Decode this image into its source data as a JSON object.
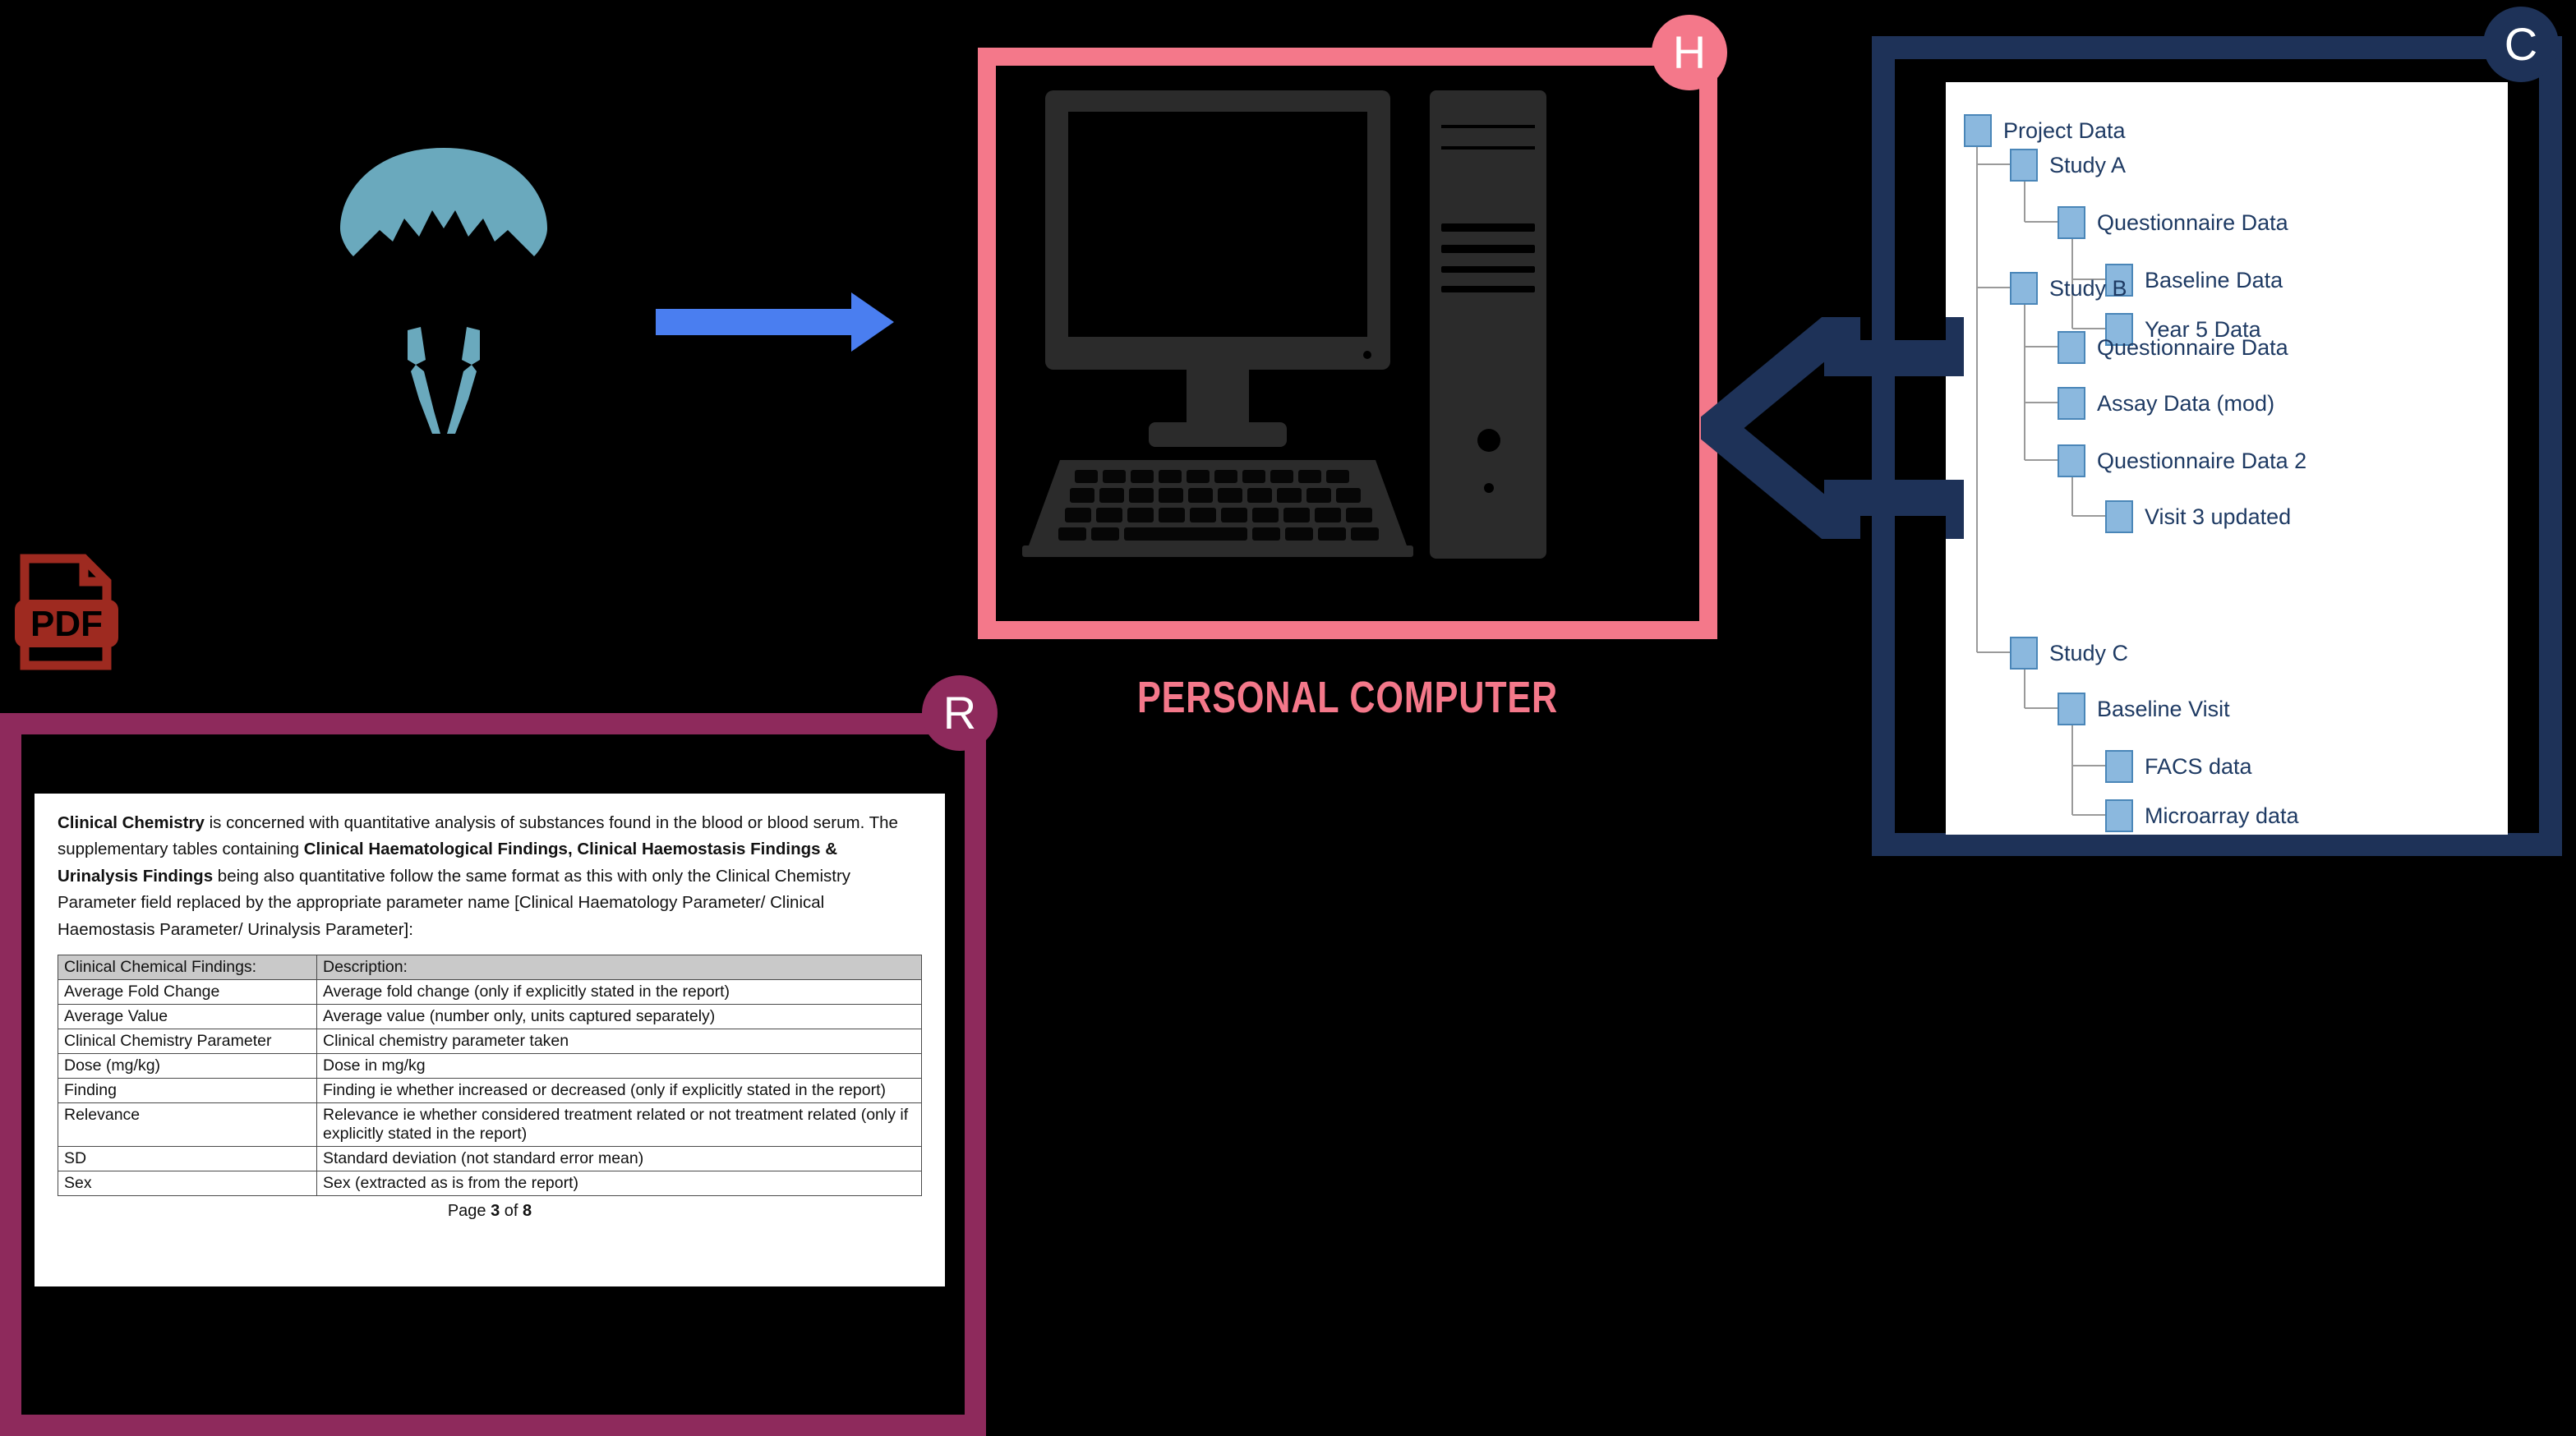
{
  "badges": {
    "h": {
      "label": "H",
      "color": "#f4788a"
    },
    "c": {
      "label": "C",
      "color": "#1e3258"
    },
    "r": {
      "label": "R",
      "color": "#8e2a5c"
    }
  },
  "computer_panel": {
    "caption": "PERSONAL COMPUTER",
    "caption_color": "#f4788a",
    "frame_color": "#f4788a",
    "icon": "desktop-computer-icon"
  },
  "source_icons": {
    "parachute": {
      "name": "parachute-icon",
      "color": "#6aa9bd"
    },
    "pdf": {
      "name": "pdf-file-icon",
      "label": "PDF",
      "color": "#9e2a20"
    },
    "blue_arrow": {
      "name": "right-arrow-icon",
      "color": "#4a7ef0"
    },
    "navy_arrow": {
      "name": "left-arrow-icon",
      "color": "#1e3258"
    }
  },
  "tree": {
    "frame_color": "#1e3258",
    "node_fill": "#8bb8de",
    "node_stroke": "#4a86b8",
    "label_color": "#1e3a63",
    "items": [
      {
        "label": "Project Data",
        "depth": 0
      },
      {
        "label": "Study A",
        "depth": 1
      },
      {
        "label": "Questionnaire Data",
        "depth": 2
      },
      {
        "label": "Baseline Data",
        "depth": 3
      },
      {
        "label": "Year 5 Data",
        "depth": 3
      },
      {
        "label": "Study B",
        "depth": 1
      },
      {
        "label": "Questionnaire Data",
        "depth": 2
      },
      {
        "label": "Assay Data (mod)",
        "depth": 2
      },
      {
        "label": "Questionnaire Data 2",
        "depth": 2
      },
      {
        "label": "Visit 3 updated",
        "depth": 3
      },
      {
        "label": "Study C",
        "depth": 1
      },
      {
        "label": "Baseline Visit",
        "depth": 2
      },
      {
        "label": "FACS data",
        "depth": 3
      },
      {
        "label": "Microarray data",
        "depth": 3
      }
    ]
  },
  "document": {
    "frame_color": "#8e2a5c",
    "paragraph_parts": [
      {
        "text": "Clinical Chemistry",
        "bold": true
      },
      {
        "text": " is concerned with quantitative analysis of substances found in the blood or blood serum. The supplementary tables containing ",
        "bold": false
      },
      {
        "text": "Clinical Haematological Findings, Clinical Haemostasis Findings & Urinalysis Findings",
        "bold": true
      },
      {
        "text": " being also quantitative follow the same format as this with only the Clinical Chemistry Parameter field replaced by the appropriate parameter name [Clinical Haematology Parameter/ Clinical Haemostasis Parameter/ Urinalysis Parameter]:",
        "bold": false
      }
    ],
    "table": {
      "headers": [
        "Clinical Chemical Findings:",
        "Description:"
      ],
      "rows": [
        [
          "Average Fold Change",
          "Average fold change (only if explicitly stated in the report)"
        ],
        [
          "Average Value",
          "Average value (number only, units captured separately)"
        ],
        [
          "Clinical Chemistry Parameter",
          "Clinical chemistry parameter taken"
        ],
        [
          "Dose (mg/kg)",
          "Dose in mg/kg"
        ],
        [
          "Finding",
          "Finding ie whether increased or decreased (only if explicitly stated in the report)"
        ],
        [
          "Relevance",
          "Relevance ie whether considered treatment related or not treatment related (only if explicitly stated in the report)"
        ],
        [
          "SD",
          "Standard deviation (not standard error mean)"
        ],
        [
          "Sex",
          "Sex (extracted as is from the report)"
        ]
      ]
    },
    "footer": {
      "prefix": "Page ",
      "page": "3",
      "middle": " of ",
      "total": "8"
    }
  }
}
